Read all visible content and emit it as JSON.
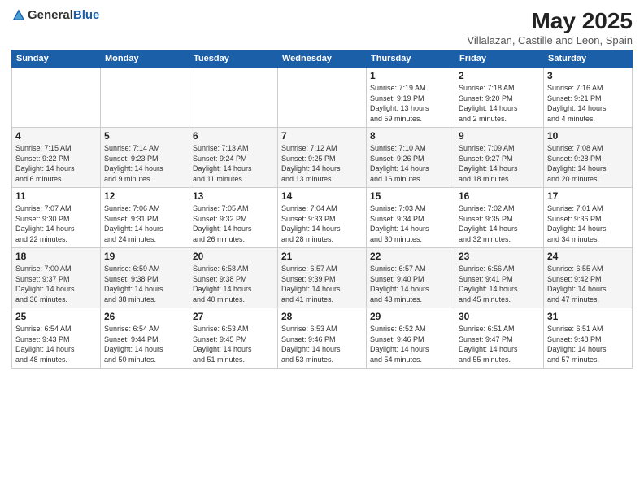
{
  "header": {
    "logo_general": "General",
    "logo_blue": "Blue",
    "month_title": "May 2025",
    "location": "Villalazan, Castille and Leon, Spain"
  },
  "weekdays": [
    "Sunday",
    "Monday",
    "Tuesday",
    "Wednesday",
    "Thursday",
    "Friday",
    "Saturday"
  ],
  "weeks": [
    [
      {
        "day": "",
        "info": ""
      },
      {
        "day": "",
        "info": ""
      },
      {
        "day": "",
        "info": ""
      },
      {
        "day": "",
        "info": ""
      },
      {
        "day": "1",
        "info": "Sunrise: 7:19 AM\nSunset: 9:19 PM\nDaylight: 13 hours\nand 59 minutes."
      },
      {
        "day": "2",
        "info": "Sunrise: 7:18 AM\nSunset: 9:20 PM\nDaylight: 14 hours\nand 2 minutes."
      },
      {
        "day": "3",
        "info": "Sunrise: 7:16 AM\nSunset: 9:21 PM\nDaylight: 14 hours\nand 4 minutes."
      }
    ],
    [
      {
        "day": "4",
        "info": "Sunrise: 7:15 AM\nSunset: 9:22 PM\nDaylight: 14 hours\nand 6 minutes."
      },
      {
        "day": "5",
        "info": "Sunrise: 7:14 AM\nSunset: 9:23 PM\nDaylight: 14 hours\nand 9 minutes."
      },
      {
        "day": "6",
        "info": "Sunrise: 7:13 AM\nSunset: 9:24 PM\nDaylight: 14 hours\nand 11 minutes."
      },
      {
        "day": "7",
        "info": "Sunrise: 7:12 AM\nSunset: 9:25 PM\nDaylight: 14 hours\nand 13 minutes."
      },
      {
        "day": "8",
        "info": "Sunrise: 7:10 AM\nSunset: 9:26 PM\nDaylight: 14 hours\nand 16 minutes."
      },
      {
        "day": "9",
        "info": "Sunrise: 7:09 AM\nSunset: 9:27 PM\nDaylight: 14 hours\nand 18 minutes."
      },
      {
        "day": "10",
        "info": "Sunrise: 7:08 AM\nSunset: 9:28 PM\nDaylight: 14 hours\nand 20 minutes."
      }
    ],
    [
      {
        "day": "11",
        "info": "Sunrise: 7:07 AM\nSunset: 9:30 PM\nDaylight: 14 hours\nand 22 minutes."
      },
      {
        "day": "12",
        "info": "Sunrise: 7:06 AM\nSunset: 9:31 PM\nDaylight: 14 hours\nand 24 minutes."
      },
      {
        "day": "13",
        "info": "Sunrise: 7:05 AM\nSunset: 9:32 PM\nDaylight: 14 hours\nand 26 minutes."
      },
      {
        "day": "14",
        "info": "Sunrise: 7:04 AM\nSunset: 9:33 PM\nDaylight: 14 hours\nand 28 minutes."
      },
      {
        "day": "15",
        "info": "Sunrise: 7:03 AM\nSunset: 9:34 PM\nDaylight: 14 hours\nand 30 minutes."
      },
      {
        "day": "16",
        "info": "Sunrise: 7:02 AM\nSunset: 9:35 PM\nDaylight: 14 hours\nand 32 minutes."
      },
      {
        "day": "17",
        "info": "Sunrise: 7:01 AM\nSunset: 9:36 PM\nDaylight: 14 hours\nand 34 minutes."
      }
    ],
    [
      {
        "day": "18",
        "info": "Sunrise: 7:00 AM\nSunset: 9:37 PM\nDaylight: 14 hours\nand 36 minutes."
      },
      {
        "day": "19",
        "info": "Sunrise: 6:59 AM\nSunset: 9:38 PM\nDaylight: 14 hours\nand 38 minutes."
      },
      {
        "day": "20",
        "info": "Sunrise: 6:58 AM\nSunset: 9:38 PM\nDaylight: 14 hours\nand 40 minutes."
      },
      {
        "day": "21",
        "info": "Sunrise: 6:57 AM\nSunset: 9:39 PM\nDaylight: 14 hours\nand 41 minutes."
      },
      {
        "day": "22",
        "info": "Sunrise: 6:57 AM\nSunset: 9:40 PM\nDaylight: 14 hours\nand 43 minutes."
      },
      {
        "day": "23",
        "info": "Sunrise: 6:56 AM\nSunset: 9:41 PM\nDaylight: 14 hours\nand 45 minutes."
      },
      {
        "day": "24",
        "info": "Sunrise: 6:55 AM\nSunset: 9:42 PM\nDaylight: 14 hours\nand 47 minutes."
      }
    ],
    [
      {
        "day": "25",
        "info": "Sunrise: 6:54 AM\nSunset: 9:43 PM\nDaylight: 14 hours\nand 48 minutes."
      },
      {
        "day": "26",
        "info": "Sunrise: 6:54 AM\nSunset: 9:44 PM\nDaylight: 14 hours\nand 50 minutes."
      },
      {
        "day": "27",
        "info": "Sunrise: 6:53 AM\nSunset: 9:45 PM\nDaylight: 14 hours\nand 51 minutes."
      },
      {
        "day": "28",
        "info": "Sunrise: 6:53 AM\nSunset: 9:46 PM\nDaylight: 14 hours\nand 53 minutes."
      },
      {
        "day": "29",
        "info": "Sunrise: 6:52 AM\nSunset: 9:46 PM\nDaylight: 14 hours\nand 54 minutes."
      },
      {
        "day": "30",
        "info": "Sunrise: 6:51 AM\nSunset: 9:47 PM\nDaylight: 14 hours\nand 55 minutes."
      },
      {
        "day": "31",
        "info": "Sunrise: 6:51 AM\nSunset: 9:48 PM\nDaylight: 14 hours\nand 57 minutes."
      }
    ]
  ]
}
